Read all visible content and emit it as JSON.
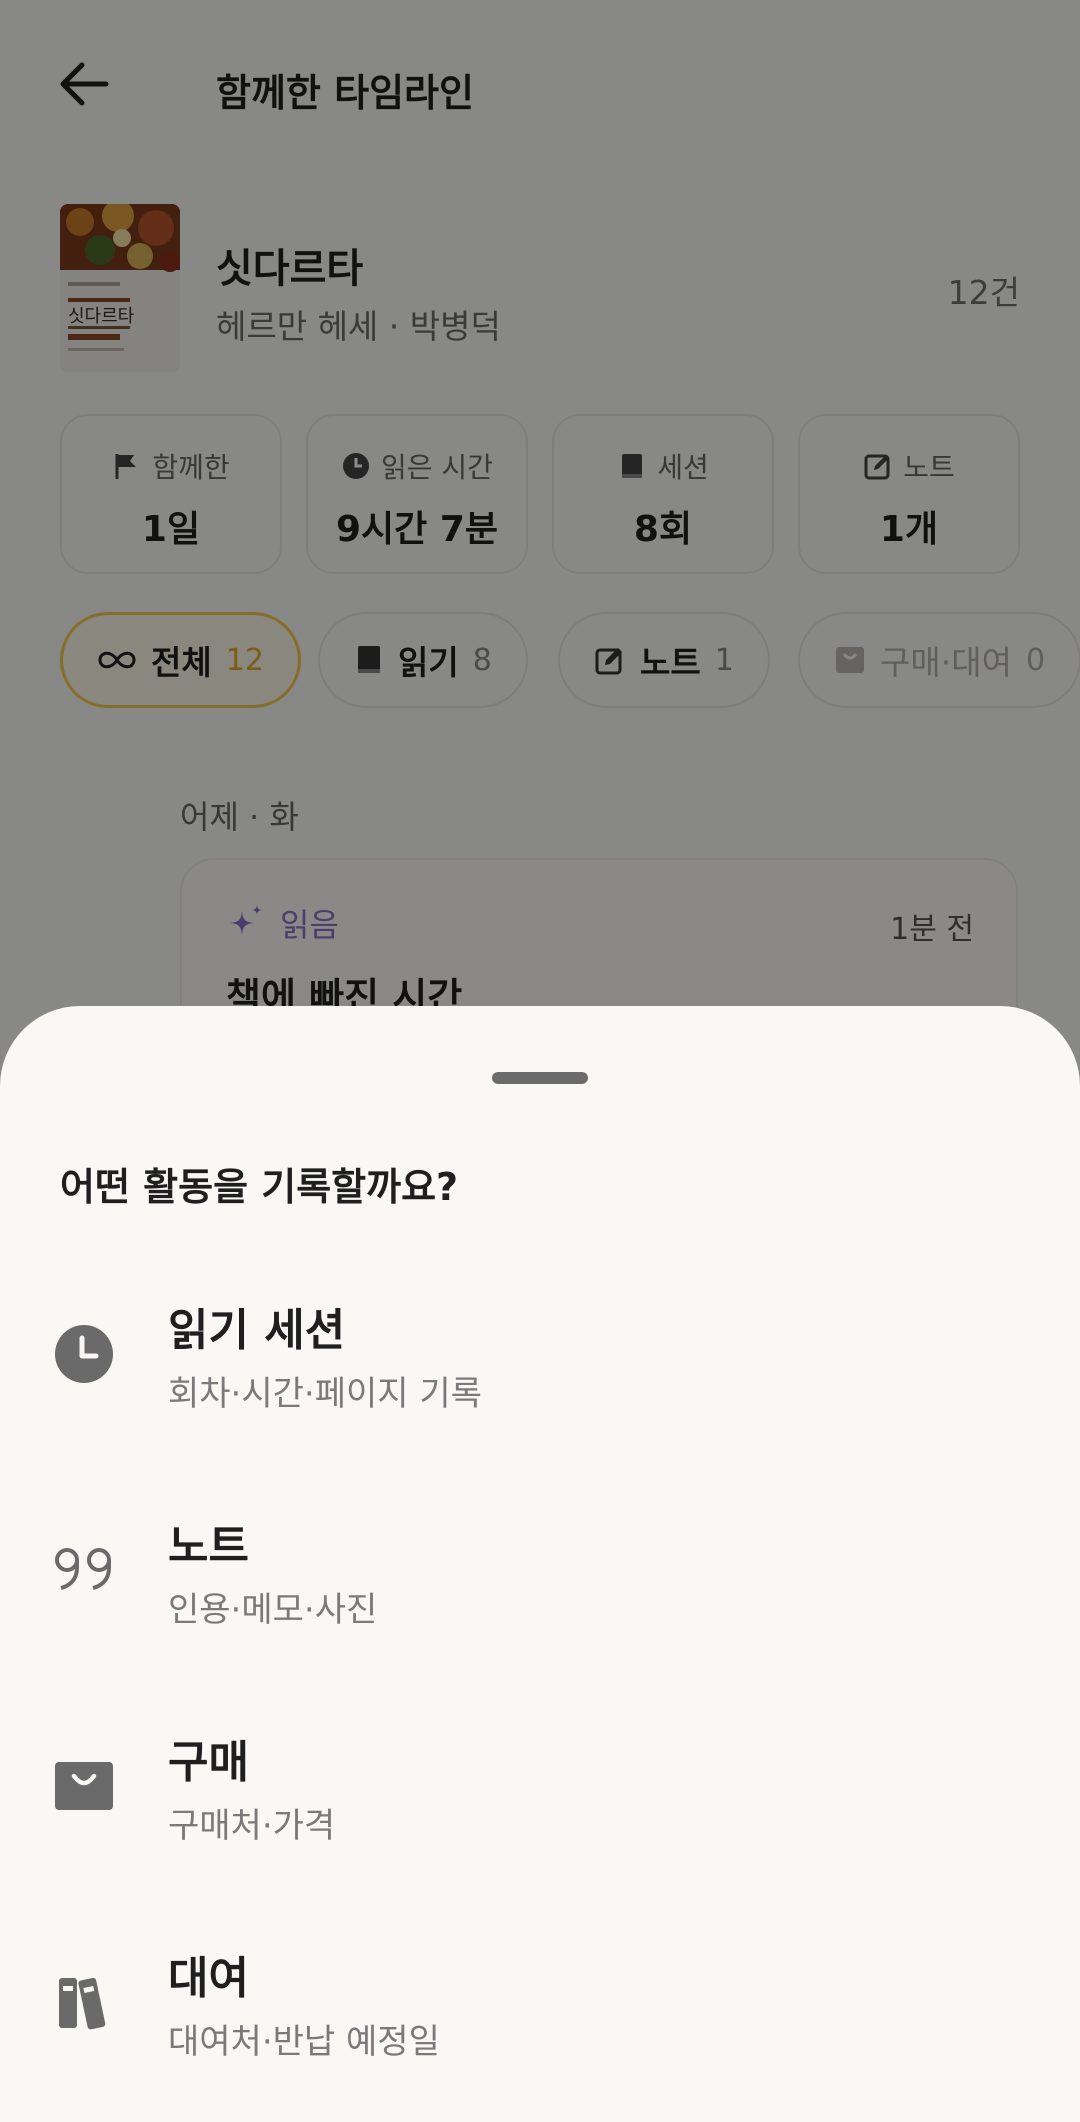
{
  "header": {
    "title": "함께한 타임라인"
  },
  "book": {
    "title": "싯다르타",
    "author": "헤르만 헤세 · 박병덕",
    "count": "12건",
    "cover_text": "싯다르타"
  },
  "stats": [
    {
      "icon": "flag-icon",
      "label": "함께한",
      "value": "1일"
    },
    {
      "icon": "clock-icon",
      "label": "읽은 시간",
      "value": "9시간 7분"
    },
    {
      "icon": "book-icon",
      "label": "세션",
      "value": "8회"
    },
    {
      "icon": "edit-icon",
      "label": "노트",
      "value": "1개"
    }
  ],
  "filters": [
    {
      "icon": "infinity-icon",
      "label": "전체",
      "count": "12",
      "active": true
    },
    {
      "icon": "book-icon",
      "label": "읽기",
      "count": "8"
    },
    {
      "icon": "edit-icon",
      "label": "노트",
      "count": "1"
    },
    {
      "icon": "bag-icon",
      "label": "구매·대여",
      "count": "0",
      "disabled": true
    }
  ],
  "timeline": {
    "day_label": "어제 · 화",
    "entry": {
      "type_label": "읽음",
      "time": "1분 전",
      "title": "책에 빠진 시간"
    }
  },
  "sheet": {
    "title": "어떤 활동을 기록할까요?",
    "options": [
      {
        "icon": "clock-icon",
        "title": "읽기 세션",
        "desc": "회차·시간·페이지 기록"
      },
      {
        "icon": "quote-icon",
        "title": "노트",
        "desc": "인용·메모·사진"
      },
      {
        "icon": "bag-icon",
        "title": "구매",
        "desc": "구매처·가격"
      },
      {
        "icon": "books-icon",
        "title": "대여",
        "desc": "대여처·반납 예정일"
      }
    ]
  },
  "colors": {
    "accent": "#f2c94c",
    "read_purple": "#8a6fc4",
    "scrim": "#000000"
  }
}
